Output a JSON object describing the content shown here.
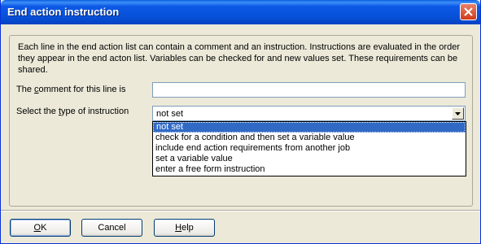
{
  "window": {
    "title": "End action instruction"
  },
  "description": "Each line in the end action list can contain a comment and an instruction.  Instructions are evaluated in the order they appear in the end acton list.  Variables can be checked for and new values set.  These requirements can be shared.",
  "comment": {
    "label_pre": "The ",
    "label_key": "c",
    "label_post": "omment for this line is",
    "value": ""
  },
  "type": {
    "label_pre": "Select the ",
    "label_key": "t",
    "label_post": "ype of instruction",
    "selected": "not set",
    "options": [
      "not set",
      "check for a condition and then set a variable value",
      "include end action requirements from another job",
      "set a variable value",
      "enter a free form instruction"
    ]
  },
  "buttons": {
    "ok_key": "O",
    "ok_rest": "K",
    "cancel": "Cancel",
    "help_key": "H",
    "help_rest": "elp"
  },
  "icons": {
    "close": "close-icon",
    "dropdown": "chevron-down-icon"
  }
}
